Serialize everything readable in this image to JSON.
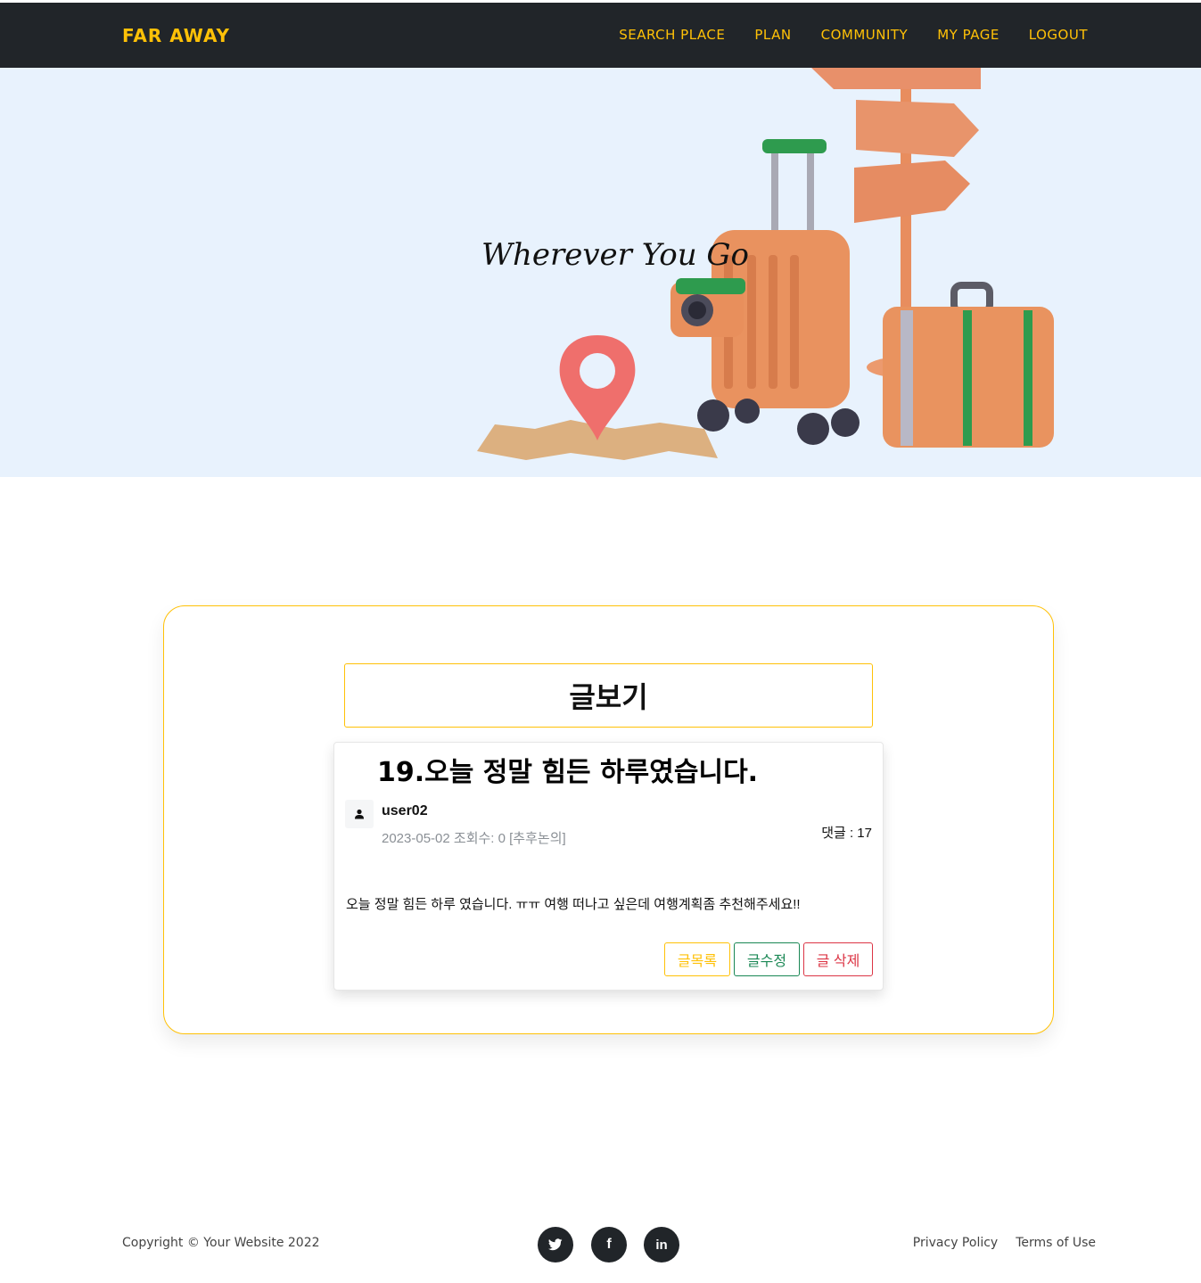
{
  "navbar": {
    "brand": "FAR AWAY",
    "links": [
      "SEARCH PLACE",
      "PLAN",
      "COMMUNITY",
      "MY PAGE",
      "LOGOUT"
    ]
  },
  "masthead": {
    "title": "Wherever You Go"
  },
  "board": {
    "heading": "글보기",
    "post": {
      "title": "19.오늘 정말 힘든 하루였습니다.",
      "author": "user02",
      "meta": "2023-05-02 조회수: 0 [추후논의]",
      "comments": "댓글 : 17",
      "content": "오늘 정말 힘든 하루 였습니다. ㅠㅠ 여행 떠나고 싶은데 여행계획좀 추천해주세요!!"
    },
    "buttons": {
      "list": "글목록",
      "edit": "글수정",
      "delete": "글 삭제"
    }
  },
  "footer": {
    "copyright": "Copyright © Your Website 2022",
    "social": [
      {
        "icon": "twitter-icon"
      },
      {
        "icon": "facebook-icon",
        "glyph": "f"
      },
      {
        "icon": "linkedin-icon",
        "glyph": "in"
      }
    ],
    "links": [
      "Privacy Policy",
      "Terms of Use"
    ]
  },
  "colors": {
    "accent": "#ffc107",
    "navbar_bg": "#212529",
    "hero_bg": "#e8f2fd",
    "success": "#198754",
    "danger": "#dc3545"
  }
}
